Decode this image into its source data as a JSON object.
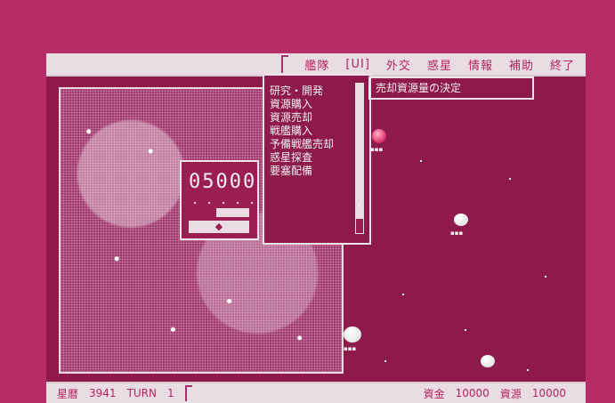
{
  "menu": {
    "items": [
      "艦隊",
      "[UI]",
      "外交",
      "惑星",
      "情報",
      "補助",
      "終了"
    ]
  },
  "command_list": {
    "items": [
      "研究・開発",
      "資源購入",
      "資源売却",
      "戦艦購入",
      "予備戦艦売却",
      "惑星探査",
      "要塞配備"
    ]
  },
  "title_box": {
    "text": "売却資源量の決定"
  },
  "quantity_popup": {
    "value": "05000",
    "digit_dots": "・・・・・",
    "progress_fraction": 0.45,
    "confirm_symbol": "◆"
  },
  "status": {
    "label_year": "星暦",
    "year": "3941",
    "label_turn": "TURN",
    "turn": "1",
    "label_funds": "資金",
    "funds": "10000",
    "label_resources": "資源",
    "resources": "10000"
  },
  "colors": {
    "background": "#9a1e52",
    "panel_text": "#f4eef2",
    "menu_bg": "#e9dde3",
    "menu_text": "#b3235f"
  }
}
